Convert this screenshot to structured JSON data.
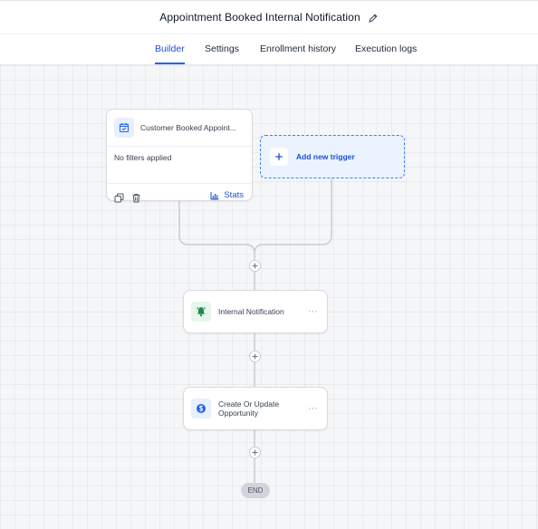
{
  "header": {
    "title": "Appointment Booked Internal Notification",
    "edit_icon": "pencil-icon"
  },
  "tabs": [
    {
      "label": "Builder",
      "active": true
    },
    {
      "label": "Settings",
      "active": false
    },
    {
      "label": "Enrollment history",
      "active": false
    },
    {
      "label": "Execution logs",
      "active": false
    }
  ],
  "trigger": {
    "name": "Customer Booked Appoint...",
    "filters_text": "No filters applied",
    "stats_label": "Stats",
    "icon": "calendar-check-icon"
  },
  "add_trigger": {
    "label": "Add new trigger"
  },
  "actions": [
    {
      "label": "Internal Notification",
      "icon": "bell-icon",
      "color": "#1b8a4a"
    },
    {
      "label": "Create Or Update Opportunity",
      "icon": "dollar-icon",
      "color": "#2563eb"
    }
  ],
  "end_label": "END",
  "colors": {
    "accent": "#2563eb",
    "canvas": "#f5f6f8"
  }
}
